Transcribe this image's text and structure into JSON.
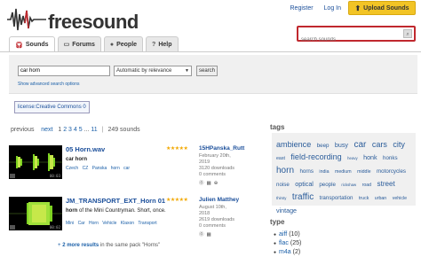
{
  "header": {
    "logo_text": "freesound",
    "links": [
      "Register",
      "Log In"
    ],
    "upload_label": "Upload Sounds",
    "search_placeholder": "search sounds"
  },
  "tabs": [
    {
      "label": "Sounds",
      "icon": "headphones-icon",
      "active": true
    },
    {
      "label": "Forums",
      "icon": "speech-bubble-icon",
      "active": false
    },
    {
      "label": "People",
      "icon": "people-icon",
      "active": false
    },
    {
      "label": "Help",
      "icon": "help-icon",
      "active": false
    }
  ],
  "search": {
    "query": "car horn",
    "sort": "Automatic by relevance",
    "button": "search",
    "advanced_link": "Show advanced search options"
  },
  "filter_tag": "license:Creative Commons 0",
  "pager": {
    "previous": "previous",
    "next": "next",
    "pages": [
      "1",
      "2",
      "3",
      "4",
      "5",
      "...",
      "11"
    ],
    "count": "249 sounds"
  },
  "results": [
    {
      "title": "05 Horn.wav",
      "desc_bold": "car horn",
      "desc_rest": "",
      "tags": [
        "Czech",
        "CZ",
        "Panska",
        "horn",
        "car"
      ],
      "user": "15HPanska_Rutt",
      "date": "February 20th,",
      "year": "2019",
      "downloads": "3120 downloads",
      "comments": "0 comments",
      "duration": "00:03",
      "stars": "★★★★★"
    },
    {
      "title": "JM_TRANSPORT_EXT_Horn 01",
      "desc_bold": "horn",
      "desc_rest": " of the Mini Countryman. Short, once.",
      "tags": [
        "Mini",
        "Car",
        "Horn",
        "Vehicle",
        "Klaxon",
        "Transport"
      ],
      "user": "Julien Matthey",
      "date": "August 10th,",
      "year": "2018",
      "downloads": "2619 downloads",
      "comments": "0 comments",
      "duration": "00:02",
      "stars": "★★★★★"
    }
  ],
  "more_results": {
    "link": "2 more results",
    "rest": "in the same pack \"Horns\""
  },
  "sidebar": {
    "tags_heading": "tags",
    "tags": [
      {
        "t": "ambience",
        "s": 9
      },
      {
        "t": "beep",
        "s": 6
      },
      {
        "t": "busy",
        "s": 7
      },
      {
        "t": "car",
        "s": 10
      },
      {
        "t": "cars",
        "s": 9
      },
      {
        "t": "city",
        "s": 9
      },
      {
        "t": "east",
        "s": 5
      },
      {
        "t": "field-recording",
        "s": 9
      },
      {
        "t": "heavy",
        "s": 4
      },
      {
        "t": "honk",
        "s": 7
      },
      {
        "t": "honks",
        "s": 6
      },
      {
        "t": "horn",
        "s": 10
      },
      {
        "t": "horns",
        "s": 6
      },
      {
        "t": "india",
        "s": 5
      },
      {
        "t": "medium",
        "s": 5
      },
      {
        "t": "middle",
        "s": 5
      },
      {
        "t": "motorcycles",
        "s": 6
      },
      {
        "t": "noise",
        "s": 6
      },
      {
        "t": "optical",
        "s": 7
      },
      {
        "t": "people",
        "s": 6
      },
      {
        "t": "rickshaw",
        "s": 4
      },
      {
        "t": "road",
        "s": 5
      },
      {
        "t": "street",
        "s": 8
      },
      {
        "t": "thirsty",
        "s": 4
      },
      {
        "t": "traffic",
        "s": 10
      },
      {
        "t": "transportation",
        "s": 6
      },
      {
        "t": "truck",
        "s": 5
      },
      {
        "t": "urban",
        "s": 5
      },
      {
        "t": "vehicle",
        "s": 5
      },
      {
        "t": "vintage",
        "s": 7
      }
    ],
    "type_heading": "type",
    "types": [
      {
        "name": "aiff",
        "count": "(10)"
      },
      {
        "name": "flac",
        "count": "(25)"
      },
      {
        "name": "m4a",
        "count": "(2)"
      }
    ]
  },
  "colors": {
    "accent_red": "#c0282e",
    "upload_yellow": "#f2c425",
    "link_blue": "#1a5fa8",
    "wave_green": "#7ed321"
  }
}
